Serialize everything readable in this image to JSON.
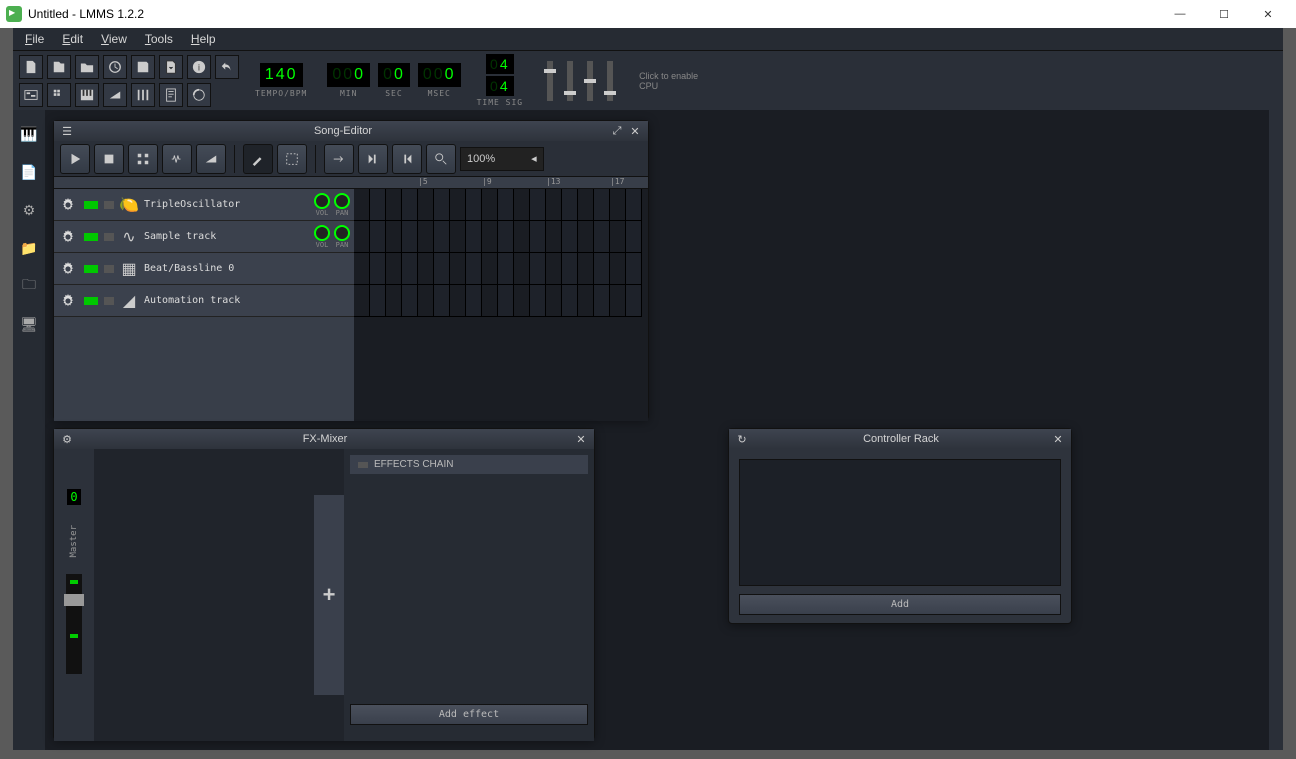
{
  "window": {
    "title": "Untitled - LMMS 1.2.2",
    "minimize": "—",
    "maximize": "☐",
    "close": "✕"
  },
  "menu": {
    "file": "File",
    "edit": "Edit",
    "view": "View",
    "tools": "Tools",
    "help": "Help"
  },
  "transport": {
    "tempo_value": "140",
    "tempo_label": "TEMPO/BPM",
    "min_value": "0",
    "min_label": "MIN",
    "sec_value": "0",
    "sec_label": "SEC",
    "msec_value": "0",
    "msec_label": "MSEC",
    "timesig_num": "4",
    "timesig_den": "4",
    "timesig_label": "TIME SIG",
    "cpu_label": "CPU",
    "cpu_hint": "Click to enable"
  },
  "song_editor": {
    "title": "Song-Editor",
    "zoom": "100%",
    "ruler_marks": [
      "|5",
      "|9",
      "|13",
      "|17"
    ],
    "tracks": [
      {
        "name": "TripleOscillator",
        "icon": "leaf",
        "has_knobs": true,
        "vol": "VOL",
        "pan": "PAN"
      },
      {
        "name": "Sample track",
        "icon": "wave",
        "has_knobs": true,
        "vol": "VOL",
        "pan": "PAN"
      },
      {
        "name": "Beat/Bassline 0",
        "icon": "grid",
        "has_knobs": false
      },
      {
        "name": "Automation track",
        "icon": "ramp",
        "has_knobs": false
      }
    ]
  },
  "fx_mixer": {
    "title": "FX-Mixer",
    "master_value": "0",
    "master_label": "Master",
    "chain_header": "EFFECTS CHAIN",
    "add_effect": "Add effect"
  },
  "controller_rack": {
    "title": "Controller Rack",
    "add": "Add"
  }
}
